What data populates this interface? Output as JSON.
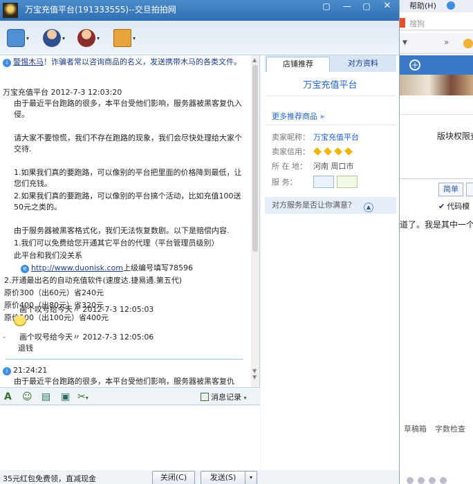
{
  "window": {
    "title": "万宝充值平台(191333555)--交旦拍拍网",
    "controls": [
      "▢",
      "—",
      "▢",
      "✕"
    ]
  },
  "toolbar": {
    "items": [
      "transfer-file",
      "contact",
      "block-user",
      "shop-basket"
    ],
    "caret": "▾"
  },
  "chat": {
    "warning": {
      "link": "警惕木马",
      "text": "！诈骗者常以咨询商品的名义，发送携带木马的各类文件。"
    },
    "messages": [
      {
        "header": "万宝充值平台  2012-7-3 12:03:20",
        "lines": [
          "由于最近平台跑路的很多，本平台受他们影响，服务器被黑客复仇入侵。",
          "",
          "请大家不要惊慌，我们不存在跑路的现象，我们会尽快处理给大家个交待.",
          "",
          "1.如果我们真的要跑路，可以像别的平台把里面的价格降到最低，让您们充钱。",
          "2.如果我们真的要跑路，可以像别的平台搞个活动，比如充值100送50元之类的。",
          "",
          "由于服务器被黑客格式化，我们无法恢复数剧。以下是赔偿内容.",
          "1.我们可以免费给您开通其它平台的代理（平台管理员级别）",
          "此平台和我们没关系"
        ],
        "link_url": "http://www.duonisk.com",
        "link_suffix": "上级编号填写78596",
        "tail": [
          "2.开通最出名的自动充值软件(速度达.捷易通.第五代)",
          "原价300（出60元）省240元",
          "原价400（出80元）省320元",
          "原价500（出100元）省400元"
        ]
      },
      {
        "dash": "-",
        "header": "画个叹号给今天〃  2012-7-3 12:05:03"
      },
      {
        "dash": "-",
        "header": "画个叹号给今天〃  2012-7-3 12:05:06",
        "text": "退钱"
      },
      {
        "header": "21:24:21",
        "text": "由于最近平台跑路的很多，本平台受他们影响，服务器被黑客复仇"
      }
    ]
  },
  "input_tools": {
    "history_label": "消息记录",
    "caret": "▾"
  },
  "bottom": {
    "promo": "35元红包免费领，直减现金",
    "close_label": "关闭(C)",
    "send_label": "发送(S)",
    "send_opt": "▾"
  },
  "side": {
    "tabs": [
      "店铺推荐",
      "对方资料"
    ],
    "shop_name": "万宝充值平台",
    "more": "更多推荐商品 »",
    "seller_nick_key": "卖家昵称：",
    "seller_nick": "万宝充值平台",
    "credit_key": "卖家信用：",
    "credit_diamonds": 4,
    "location_key": "所 在 地：",
    "location": "河南 周口市",
    "service_key": "服    务：",
    "satisfaction": "对方服务是否让你满意？"
  },
  "background": {
    "help": "帮助(H)",
    "search_placeholder": "搜狗",
    "more": "»",
    "plus": "+",
    "perm": "版块权限查",
    "simple_btn": "简单",
    "code_mode": "代码模",
    "post_text": "道了。我是其中一个",
    "bottom_links": [
      "草稿箱",
      "字数检查"
    ]
  }
}
